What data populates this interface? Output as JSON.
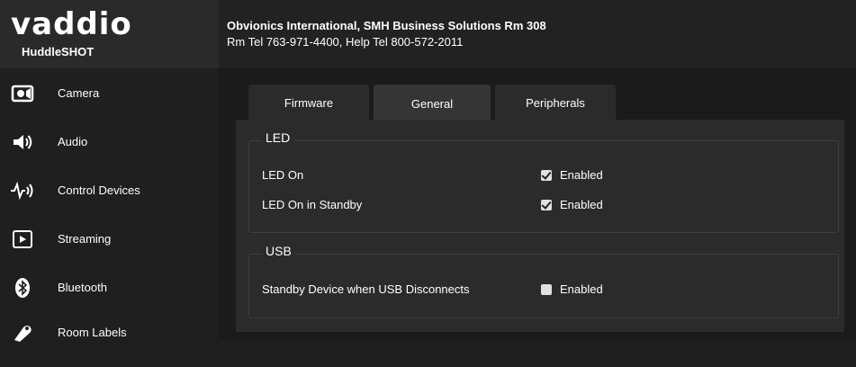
{
  "header": {
    "logo": "vaddio",
    "model": "HuddleSHOT",
    "contact_line1": "Obvionics International, SMH Business Solutions Rm 308",
    "contact_line2": "Rm Tel 763-971-4400, Help Tel 800-572-2011"
  },
  "sidebar": {
    "items": [
      {
        "label": "Camera",
        "icon": "camera-icon"
      },
      {
        "label": "Audio",
        "icon": "speaker-icon"
      },
      {
        "label": "Control Devices",
        "icon": "control-devices-icon"
      },
      {
        "label": "Streaming",
        "icon": "play-icon"
      },
      {
        "label": "Bluetooth",
        "icon": "bluetooth-icon"
      },
      {
        "label": "Room Labels",
        "icon": "room-labels-icon"
      }
    ]
  },
  "tabs": [
    {
      "label": "Firmware",
      "active": false
    },
    {
      "label": "General",
      "active": true
    },
    {
      "label": "Peripherals",
      "active": false
    }
  ],
  "led": {
    "legend": "LED",
    "rows": [
      {
        "label": "LED On",
        "checkbox_label": "Enabled",
        "checked": true
      },
      {
        "label": "LED On in Standby",
        "checkbox_label": "Enabled",
        "checked": true
      }
    ]
  },
  "usb": {
    "legend": "USB",
    "rows": [
      {
        "label": "Standby Device when USB Disconnects",
        "checkbox_label": "Enabled",
        "checked": false
      }
    ]
  },
  "colors": {
    "background": "#1e1e1e",
    "panel": "#2b2b2b",
    "active_tab": "#353535",
    "text": "#ffffff"
  }
}
